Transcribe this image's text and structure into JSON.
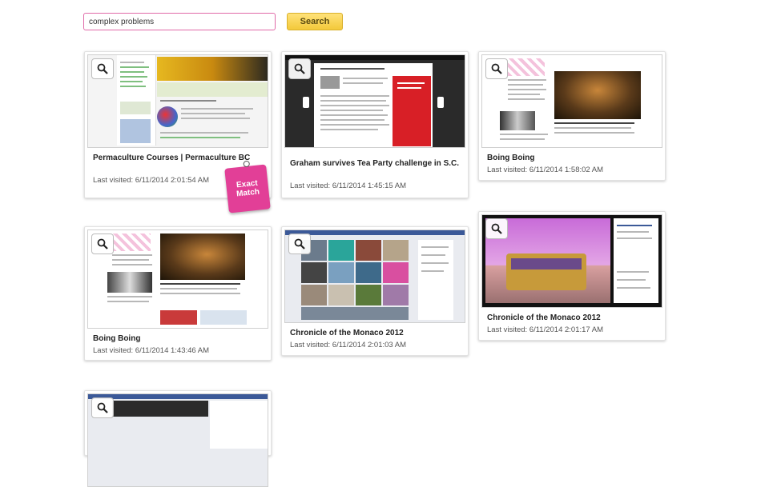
{
  "search": {
    "value": "complex problems",
    "button_label": "Search"
  },
  "cards": [
    {
      "title": "Permaculture Courses | Permaculture BC",
      "visited": "Last visited: 6/11/2014 2:01:54 AM",
      "badge": "Exact Match"
    },
    {
      "title": "Graham survives Tea Party challenge in S.C.",
      "visited": "Last visited: 6/11/2014 1:45:15 AM"
    },
    {
      "title": "Boing Boing",
      "visited": "Last visited: 6/11/2014 1:58:02 AM"
    },
    {
      "title": "Boing Boing",
      "visited": "Last visited: 6/11/2014 1:43:46 AM"
    },
    {
      "title": "Chronicle of the Monaco 2012",
      "visited": "Last visited: 6/11/2014 2:01:03 AM"
    },
    {
      "title": "Chronicle of the Monaco 2012",
      "visited": "Last visited: 6/11/2014 2:01:17 AM"
    },
    {
      "title": "",
      "visited": ""
    }
  ],
  "colors": {
    "accent_pink": "#e23f97",
    "search_border": "#e06aa8",
    "button_yellow": "#f3c93a"
  },
  "icons": {
    "zoom": "magnifier-icon"
  }
}
